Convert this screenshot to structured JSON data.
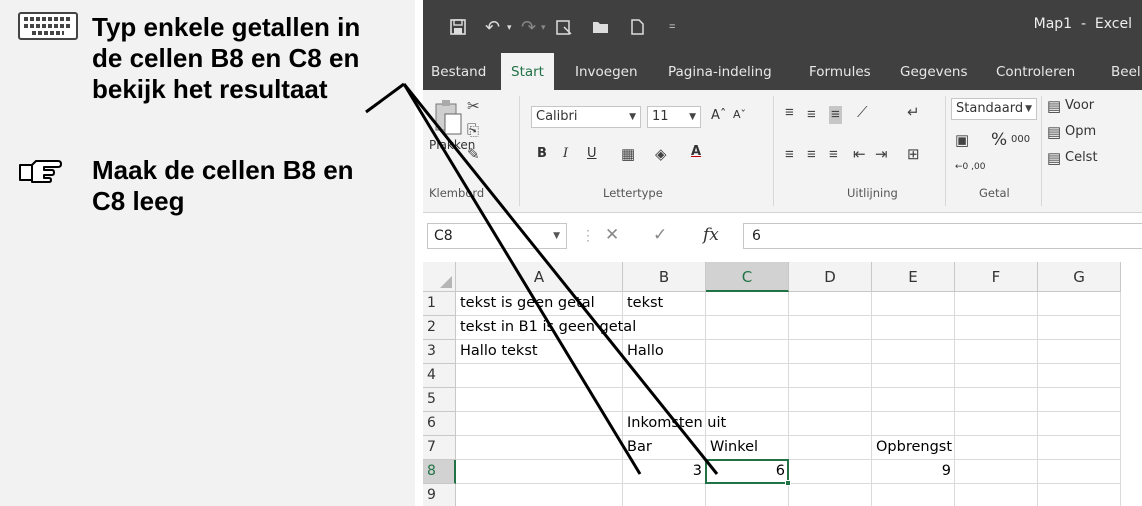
{
  "instructions": [
    {
      "icon": "keyboard-icon",
      "text": "Typ enkele getallen in\nde cellen B8 en C8 en\nbekijk het resultaat"
    },
    {
      "icon": "pointing-hand-icon",
      "text": "Maak de cellen B8 en\nC8 leeg"
    }
  ],
  "excel": {
    "title": "Map1  -  Excel",
    "tabs": [
      "Bestand",
      "Start",
      "Invoegen",
      "Pagina-indeling",
      "Formules",
      "Gegevens",
      "Controleren",
      "Beel"
    ],
    "active_tab": "Start",
    "ribbon": {
      "groups": [
        "Klembord",
        "Lettertype",
        "Uitlijning",
        "Getal"
      ],
      "paste_label": "Plakken",
      "font_name": "Calibri",
      "font_size": "11",
      "number_format": "Standaard",
      "percent": "%",
      "thousands": "000",
      "styles": [
        "Voor",
        "Opm",
        "Celst"
      ]
    },
    "formula_bar": {
      "name_box": "C8",
      "fx": "fx",
      "content": "6"
    },
    "columns": [
      "A",
      "B",
      "C",
      "D",
      "E",
      "F",
      "G"
    ],
    "selected_column": "C",
    "selected_row": "8",
    "rows": [
      {
        "n": "1",
        "A": "tekst is geen getal",
        "B": "tekst"
      },
      {
        "n": "2",
        "A": "tekst in B1 is geen getal"
      },
      {
        "n": "3",
        "A": "Hallo tekst",
        "B": "Hallo"
      },
      {
        "n": "4"
      },
      {
        "n": "5"
      },
      {
        "n": "6",
        "B": "Inkomsten uit"
      },
      {
        "n": "7",
        "B": "Bar",
        "C": "Winkel",
        "E": "Opbrengst"
      },
      {
        "n": "8",
        "B": "3",
        "C": "6",
        "E": "9"
      },
      {
        "n": "9"
      }
    ],
    "accent_color": "#217346",
    "titlebar_color": "#404040"
  }
}
